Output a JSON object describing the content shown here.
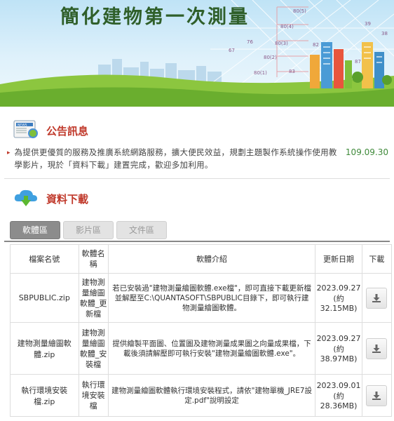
{
  "banner": {
    "title": "簡化建物第一次測量",
    "grid_labels": [
      "80(5)",
      "80(4)",
      "80(3)",
      "80(2)",
      "80(1)",
      "67",
      "76",
      "39",
      "38",
      "82",
      "83",
      "87"
    ]
  },
  "announcement": {
    "title": "公告訊息",
    "icon": "news-icon",
    "items": [
      {
        "text": "為提供更優質的服務及推廣系統網路服務，擴大便民效益，規劃主題製作系統操作使用教學影片，現於「資料下載」建置完成，歡迎多加利用。",
        "date": "109.09.30"
      }
    ]
  },
  "downloads": {
    "title": "資料下載",
    "icon": "cloud-download-icon",
    "tabs": [
      "軟體區",
      "影片區",
      "文件區"
    ],
    "active_tab": "軟體區",
    "columns": [
      "檔案名號",
      "軟體名稱",
      "軟體介紹",
      "更新日期",
      "下載"
    ],
    "rows": [
      {
        "file": "SBPUBLIC.zip",
        "name": "建物測量繪圖軟體_更新檔",
        "desc": "若已安裝過\"建物測量繪圖軟體.exe檔\"，即可直接下載更新檔並解壓至C:\\QUANTASOFT\\SBPUBLIC目錄下，即可執行建物測量繪圖軟體。",
        "date": "2023.09.27",
        "size": "(約32.15MB)"
      },
      {
        "file": "建物測量繪圖軟體.zip",
        "name": "建物測量繪圖軟體_安裝檔",
        "desc": "提供繪製平面圖、位置圖及建物測量成果圖之向量成果檔，下載後須請解壓即可執行安裝\"建物測量繪圖軟體.exe\"。",
        "date": "2023.09.27",
        "size": "(約38.97MB)"
      },
      {
        "file": "執行環境安裝檔.zip",
        "name": "執行環境安裝檔",
        "desc": "建物測量繪圖軟體執行環境安裝程式，請依\"建物單機_JRE7設定.pdf\"說明設定",
        "date": "2023.09.01",
        "size": "(約28.36MB)"
      }
    ]
  },
  "colors": {
    "title_red": "#c0392b",
    "date_green": "#3f8a3a",
    "banner_sky": "#bfe3f6",
    "grass": "#7fbf3a",
    "tab_active": "#8c8c8c"
  }
}
